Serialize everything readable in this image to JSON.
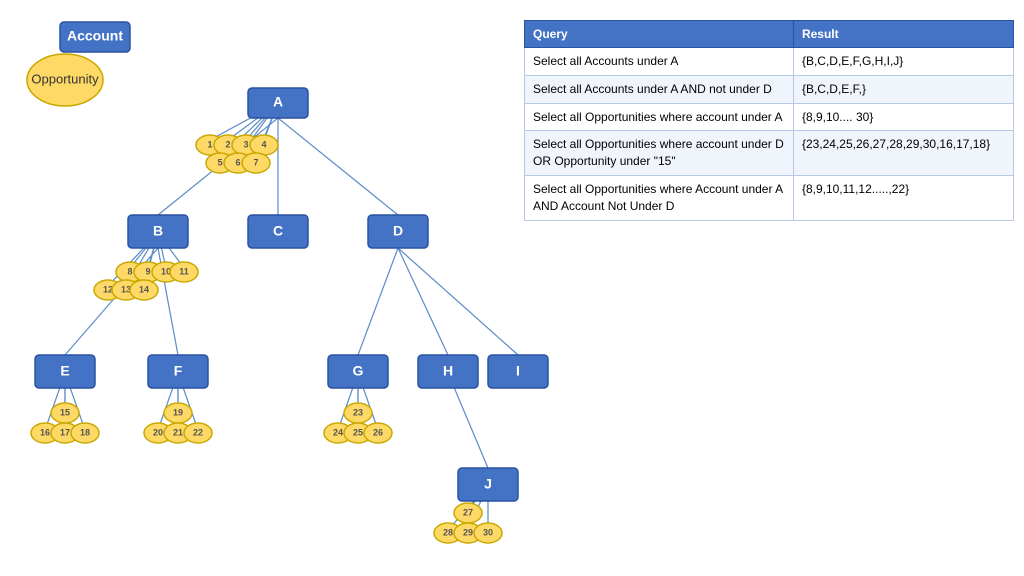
{
  "legend": {
    "account_label": "Account",
    "opportunity_label": "Opportunity"
  },
  "table": {
    "col1": "Query",
    "col2": "Result",
    "rows": [
      {
        "query": "Select all Accounts under A",
        "result": "{B,C,D,E,F,G,H,I,J}"
      },
      {
        "query": "Select all Accounts under A AND not under D",
        "result": "{B,C,D,E,F,}"
      },
      {
        "query": "Select all Opportunities where account under A",
        "result": "{8,9,10.... 30}"
      },
      {
        "query": "Select all Opportunities where account under D OR Opportunity under \"15\"",
        "result": "{23,24,25,26,27,28,29,30,16,17,18}"
      },
      {
        "query": "Select all Opportunities where Account under A AND Account Not Under D",
        "result": "{8,9,10,11,12.....,22}"
      }
    ]
  },
  "nodes": {
    "accounts": [
      "A",
      "B",
      "C",
      "D",
      "E",
      "F",
      "G",
      "H",
      "I",
      "J"
    ],
    "opportunities": [
      "1",
      "2",
      "3",
      "4",
      "5",
      "6",
      "7",
      "8",
      "9",
      "10",
      "11",
      "12",
      "13",
      "14",
      "15",
      "16",
      "17",
      "18",
      "19",
      "20",
      "21",
      "22",
      "23",
      "24",
      "25",
      "26",
      "27",
      "28",
      "29",
      "30"
    ]
  }
}
